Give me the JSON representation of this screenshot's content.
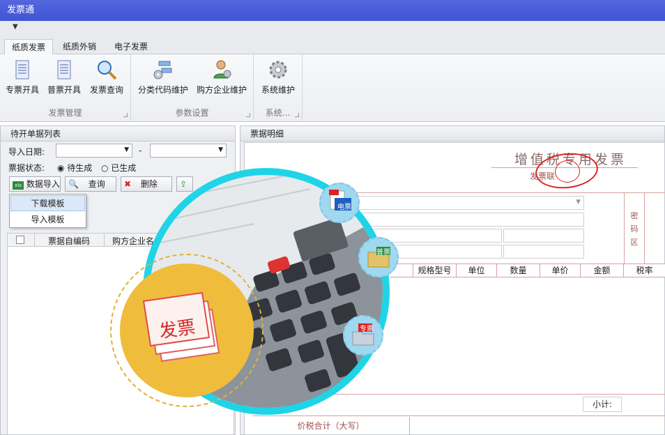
{
  "app": {
    "title": "发票通"
  },
  "tabs": [
    "纸质发票",
    "纸质外销",
    "电子发票"
  ],
  "ribbon": {
    "groups": [
      {
        "label": "发票管理",
        "buttons": [
          "专票开具",
          "普票开具",
          "发票查询"
        ]
      },
      {
        "label": "参数设置",
        "buttons": [
          "分类代码维护",
          "购方企业维护"
        ]
      },
      {
        "label": "系统...",
        "buttons": [
          "系统维护"
        ]
      }
    ]
  },
  "left": {
    "header": "待开单据列表",
    "import_date_label": "导入日期:",
    "date_sep": "-",
    "status_label": "票据状态:",
    "status_opts": [
      "待生成",
      "已生成"
    ],
    "buttons": {
      "import": "数据导入",
      "query": "查询",
      "delete": "删除"
    },
    "menu": [
      "下载模板",
      "导入模板"
    ],
    "grid_cols": [
      "票据自编码",
      "购方企业名"
    ]
  },
  "right": {
    "header": "票据明细",
    "invoice_title": "增值税专用发票",
    "invoice_sub": "发票联",
    "pwd_area": "密码区",
    "cols": [
      "规格型号",
      "单位",
      "数量",
      "单价",
      "金额",
      "税率"
    ],
    "subtotal": "小计:",
    "total_label": "价税合计（大写）"
  },
  "hero": {
    "badges": [
      "电票",
      "普票",
      "专票"
    ],
    "main": "发票"
  },
  "colors": {
    "title_bg": "#3f55d6",
    "ring": "#1fd4e6",
    "yellow": "#f0bc3c",
    "invoice_red": "#d22222"
  }
}
